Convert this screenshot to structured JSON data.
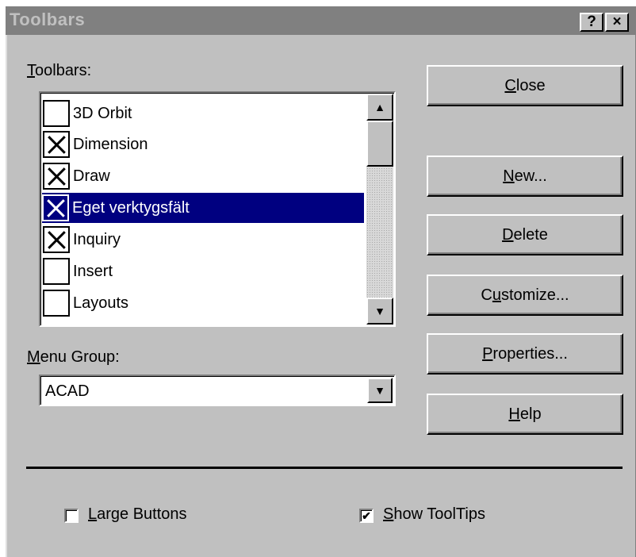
{
  "window": {
    "title": "Toolbars",
    "help_btn": "?",
    "close_btn": "×"
  },
  "toolbars": {
    "label_underlined": "T",
    "label_rest": "oolbars:",
    "items": [
      {
        "label": "3D Orbit",
        "checked": false,
        "selected": false
      },
      {
        "label": "Dimension",
        "checked": true,
        "selected": false
      },
      {
        "label": "Draw",
        "checked": true,
        "selected": false
      },
      {
        "label": "Eget verktygsfält",
        "checked": true,
        "selected": true
      },
      {
        "label": "Inquiry",
        "checked": true,
        "selected": false
      },
      {
        "label": "Insert",
        "checked": false,
        "selected": false
      },
      {
        "label": "Layouts",
        "checked": false,
        "selected": false
      }
    ],
    "scroll_up": "▲",
    "scroll_down": "▼"
  },
  "menu_group": {
    "label_underlined": "M",
    "label_rest": "enu Group:",
    "value": "ACAD",
    "dropdown_arrow": "▼"
  },
  "buttons": {
    "close": {
      "u": "C",
      "rest": "lose"
    },
    "new": {
      "u": "N",
      "rest": "ew..."
    },
    "delete": {
      "u": "D",
      "rest": "elete"
    },
    "customize": {
      "pre": "C",
      "u": "u",
      "rest": "stomize..."
    },
    "properties": {
      "u": "P",
      "rest": "roperties..."
    },
    "help": {
      "u": "H",
      "rest": "elp"
    }
  },
  "options": {
    "large_buttons": {
      "u": "L",
      "rest": "arge Buttons",
      "checked": false
    },
    "show_tooltips": {
      "u": "S",
      "rest": "how ToolTips",
      "checked": true,
      "mark": "✔"
    }
  }
}
